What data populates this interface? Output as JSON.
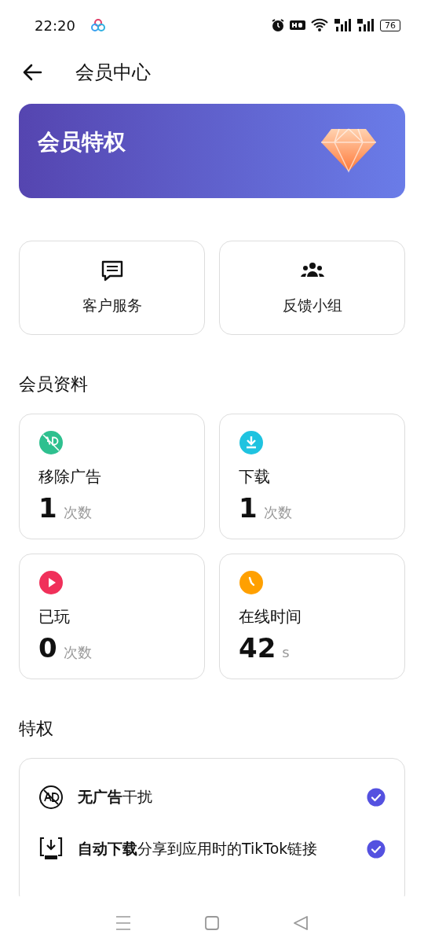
{
  "status_bar": {
    "time": "22:20",
    "battery": "76"
  },
  "header": {
    "title": "会员中心"
  },
  "banner": {
    "title": "会员特权"
  },
  "services": [
    {
      "kind": "chat",
      "label": "客户服务"
    },
    {
      "kind": "group",
      "label": "反馈小组"
    }
  ],
  "stats_heading": "会员资料",
  "stats": [
    {
      "kind": "ad-off",
      "color": "#2ec08f",
      "label": "移除广告",
      "value": "1",
      "unit": "次数"
    },
    {
      "kind": "download",
      "color": "#1fc3e0",
      "label": "下载",
      "value": "1",
      "unit": "次数"
    },
    {
      "kind": "play",
      "color": "#f0305a",
      "label": "已玩",
      "value": "0",
      "unit": "次数"
    },
    {
      "kind": "clock",
      "color": "#ffa000",
      "label": "在线时间",
      "value": "42",
      "unit": "s"
    }
  ],
  "privileges_heading": "特权",
  "privileges": [
    {
      "kind": "ad-off",
      "text": "**无广告**干扰",
      "checked": true
    },
    {
      "kind": "auto-download",
      "text": "**自动下载**分享到应用时的TikTok链接",
      "checked": true
    }
  ]
}
